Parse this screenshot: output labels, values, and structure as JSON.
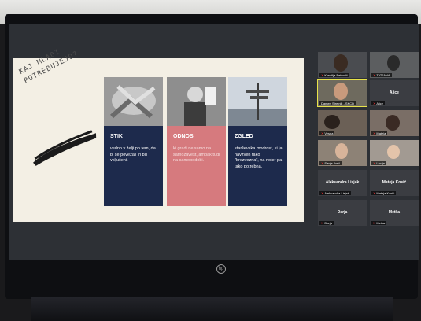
{
  "slide": {
    "title": "KAJ MLADI POTREBUJEJO?",
    "cards": [
      {
        "title": "STIK",
        "text": "vedno v želji po tem, da bi se povezali in bili vključeni."
      },
      {
        "title": "ODNOS",
        "text": "ki gradi ne samo na samozavest, ampak tudi na samopodobi."
      },
      {
        "title": "ZGLED",
        "text": "starševska modrost, ki ja navzven tako \"brezvezna\", na noter pa tako potrebna."
      }
    ]
  },
  "participants": [
    {
      "name": "Klavdija Petrovič",
      "video": true
    },
    {
      "name": "TATJANA",
      "video": true
    },
    {
      "name": "Damen Strelnik - SKCD",
      "video": true
    },
    {
      "name": "Alice",
      "video": false
    },
    {
      "name": "Vesna",
      "video": true
    },
    {
      "name": "Mateja",
      "video": true
    },
    {
      "name": "Sanja Jurič",
      "video": true
    },
    {
      "name": "Lucija",
      "video": true
    },
    {
      "name": "Aleksandra Lisjak",
      "video": false
    },
    {
      "name": "Mateja Kosić",
      "video": false
    },
    {
      "name": "Darja",
      "video": false
    },
    {
      "name": "Metka",
      "video": false
    }
  ],
  "laptop_logo": "hp",
  "colors": {
    "card_navy": "#1d2a4c",
    "card_pink": "#d67a7e",
    "active_speaker": "#e8e34a"
  }
}
